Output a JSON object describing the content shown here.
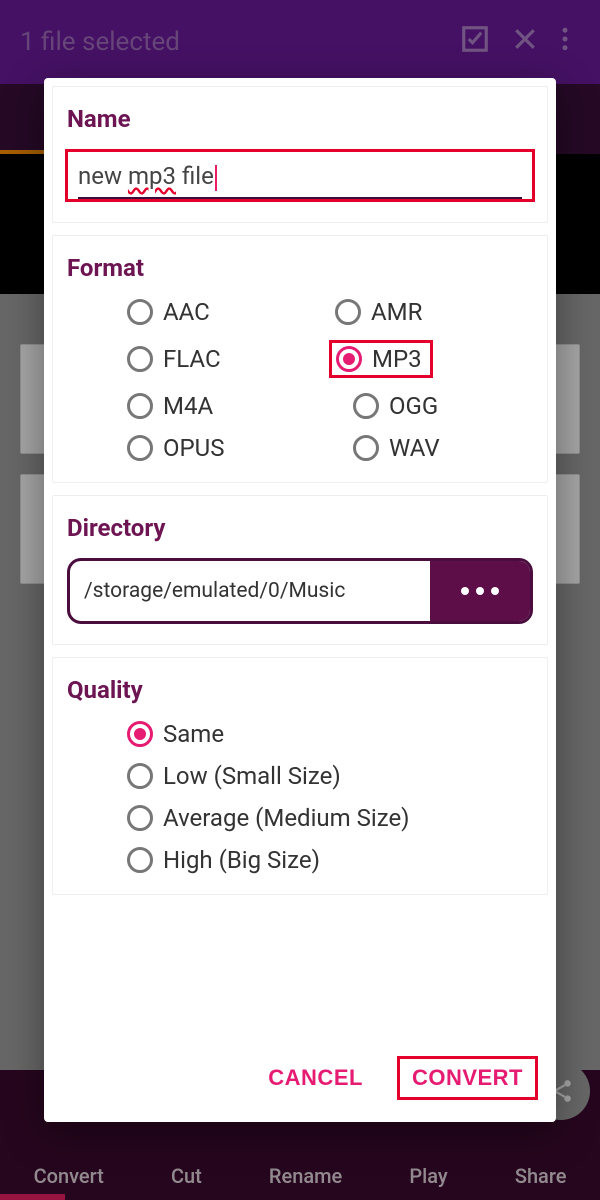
{
  "appbar": {
    "title": "1 file selected"
  },
  "bottom_tabs": [
    "Convert",
    "Cut",
    "Rename",
    "Play",
    "Share"
  ],
  "dialog": {
    "name": {
      "heading": "Name",
      "value_prefix": "new ",
      "value_spelled": "mp3",
      "value_suffix": " file"
    },
    "format": {
      "heading": "Format",
      "options": [
        "AAC",
        "AMR",
        "FLAC",
        "MP3",
        "M4A",
        "OGG",
        "OPUS",
        "WAV"
      ],
      "selected": "MP3"
    },
    "directory": {
      "heading": "Directory",
      "path": "/storage/emulated/0/Music"
    },
    "quality": {
      "heading": "Quality",
      "options": [
        "Same",
        "Low (Small Size)",
        "Average (Medium Size)",
        "High (Big Size)"
      ],
      "selected": "Same"
    },
    "actions": {
      "cancel": "CANCEL",
      "convert": "CONVERT"
    }
  }
}
